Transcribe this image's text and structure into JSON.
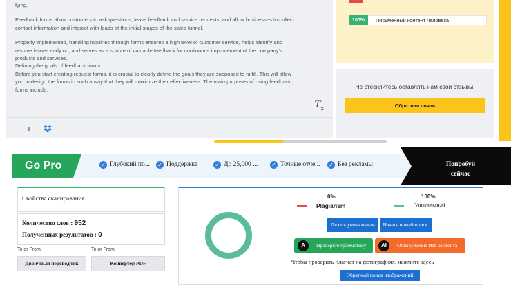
{
  "editor": {
    "lines": [
      "fying.",
      "Feedback forms allow customers to ask questions, leave feedback and service requests, and allow businesses to collect",
      "contact information and interact with leads at the initial stages of the sales funnel.",
      "Properly implemented, handling inquiries through forms ensures a high level of customer service, helps identify and",
      "resolve issues early on, and serves as a source of valuable feedback for continuous improvement of the company's",
      "products and services.",
      "Defining the goals of feedback forms",
      "Before you start creating request forms, it is crucial to clearly define the goals they are supposed to fulfill. This will allow",
      "you to design the forms in such a way that they will maximize their effectiveness. The main purposes of using feedback",
      "forms include:"
    ],
    "clear_format_glyph": "T",
    "clear_format_sub": "x",
    "plus_label": "+"
  },
  "sidebar": {
    "badge_value": "100%",
    "badge_label": "Письменный контент человека",
    "feedback_prompt": "Не стесняйтесь оставлять нам свои отзывы.",
    "feedback_button": "Обратная связь"
  },
  "banner": {
    "gopro_label": "Go Pro",
    "features": [
      "Глубокий по...",
      "Поддержка",
      "До 25,000 ...",
      "Точные отче...",
      "Без рекламы"
    ],
    "try_line1": "Попробуй",
    "try_line2": "сейчас"
  },
  "scan": {
    "title": "Свойства сканирования",
    "word_count_label": "Количество слов :",
    "word_count_value": "952",
    "results_label": "Полученных результатов :",
    "results_value": "0"
  },
  "tools": [
    {
      "caption": "To or From",
      "label": "Двоичный переводчик"
    },
    {
      "caption": "To or From",
      "label": "Конвертер PDF"
    }
  ],
  "results": {
    "plagiarism_pct": "0%",
    "unique_pct": "100%",
    "plagiarism_label": "Plagiarism",
    "unique_label": "Уникальный",
    "make_unique_button": "Делать уникальным",
    "new_search_button": "Начать новый поиск.",
    "grammar_button": "Проверьте грамматику",
    "ai_button": "Обнаружение ИИ-контента",
    "photo_note": "Чтобы проверить плагиат на фотографиях, нажмите здесь",
    "reverse_image_button": "Обратный поиск изображений"
  },
  "colors": {
    "green": "#26a65b",
    "blue": "#1d6fd1",
    "yellow": "#fcc419",
    "red": "#e5484d",
    "orange": "#f26b2a",
    "teal_ring": "#5dbc98"
  }
}
